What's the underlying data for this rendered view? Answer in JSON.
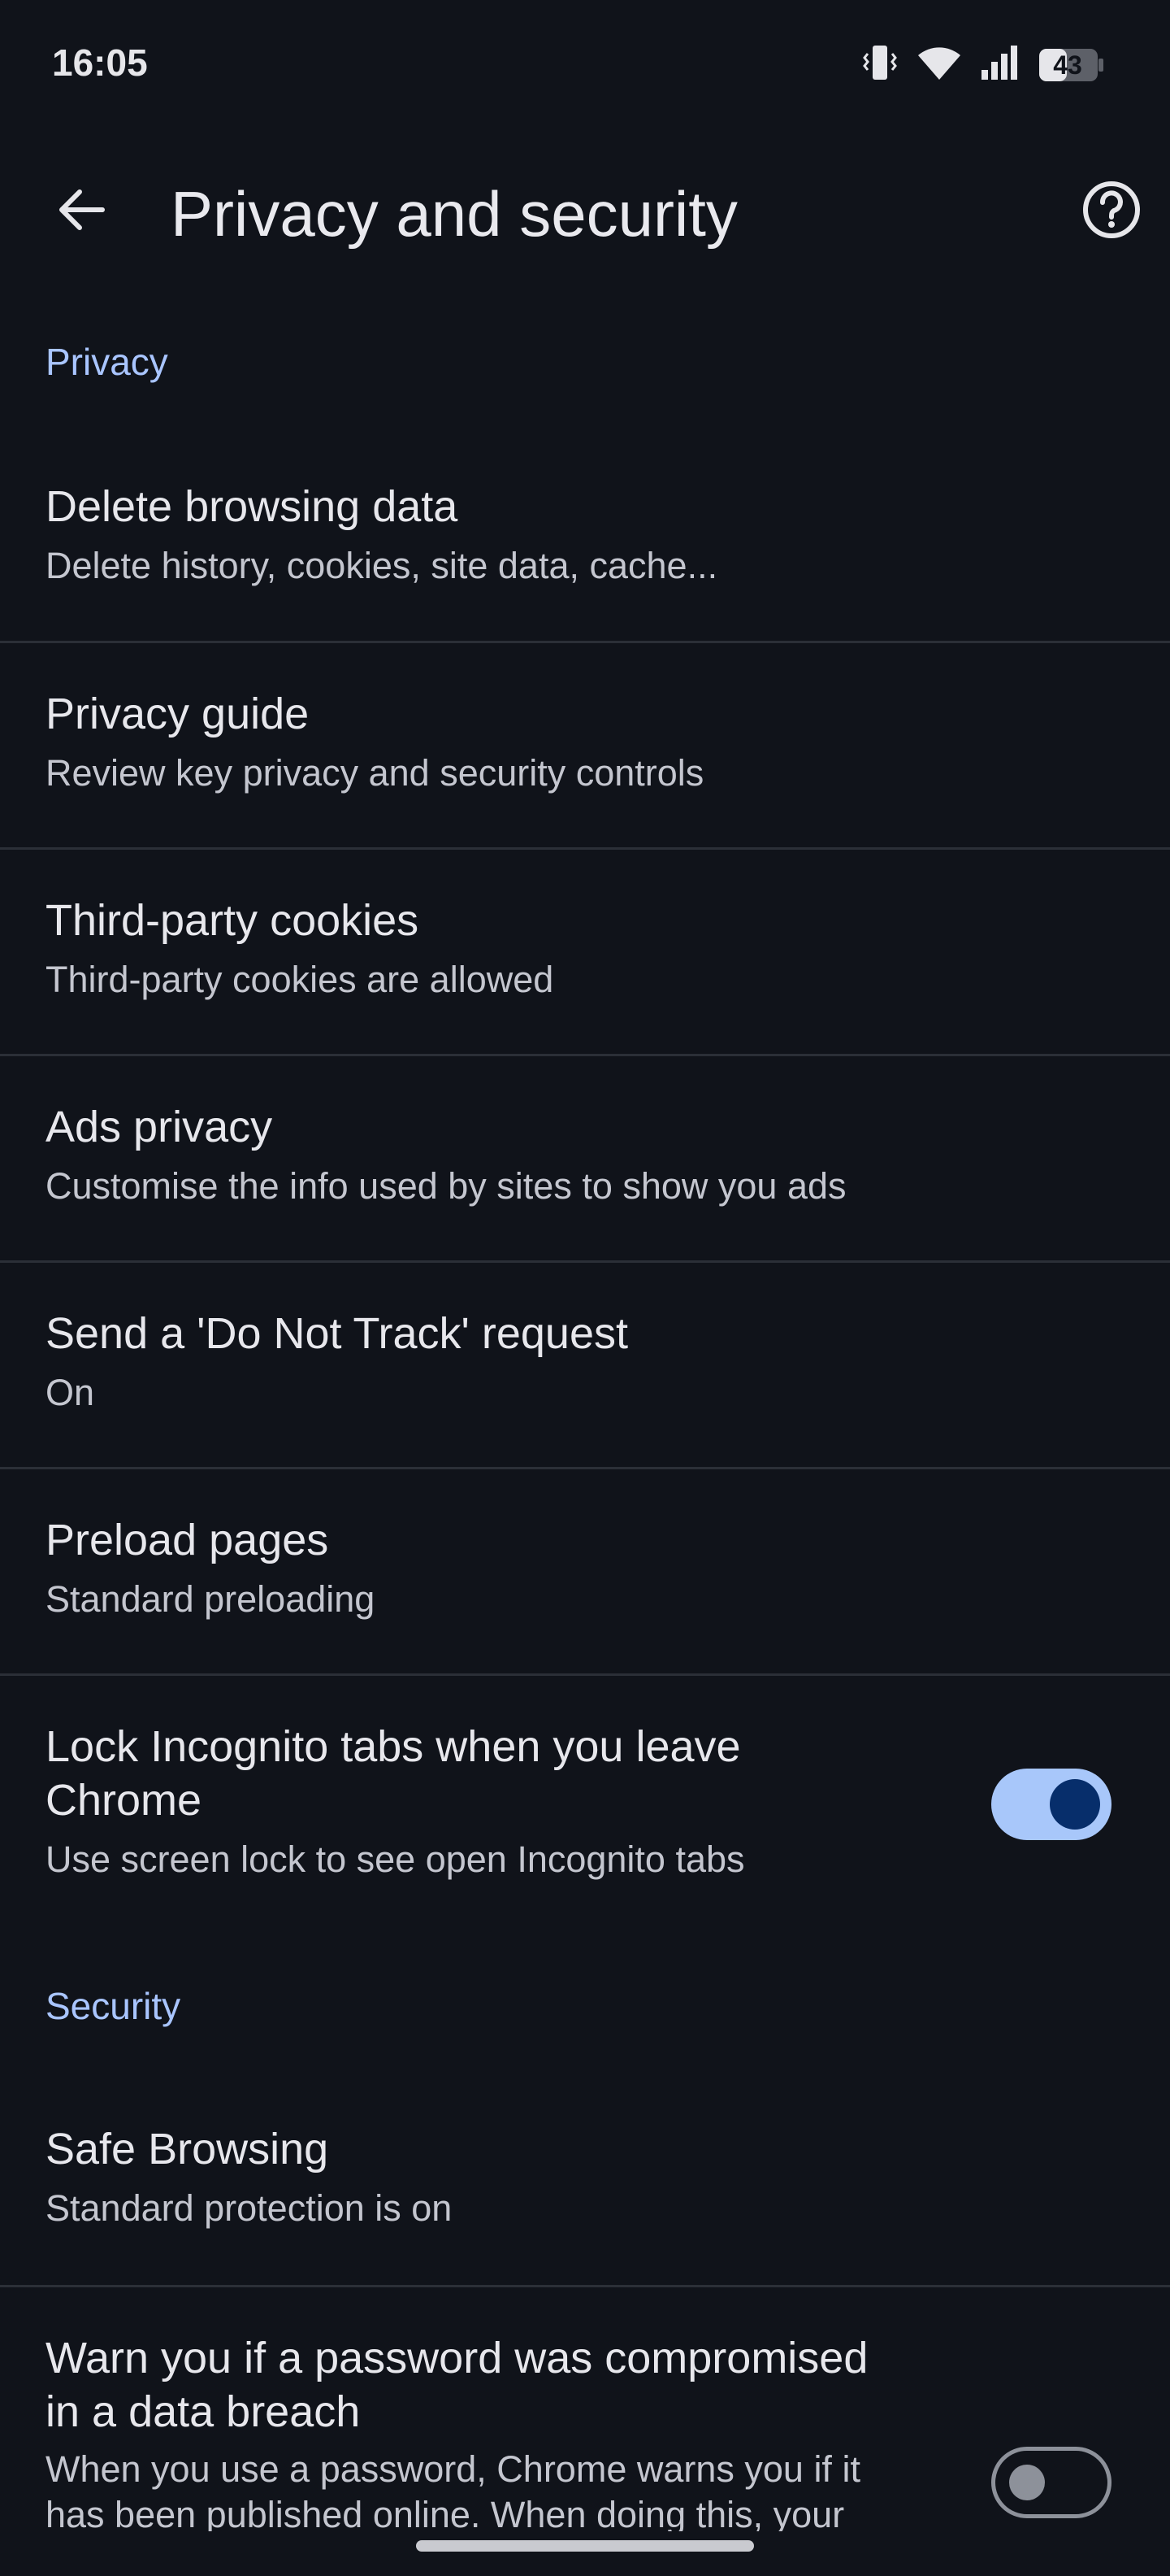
{
  "status_bar": {
    "time": "16:05",
    "battery": "43",
    "icons": [
      "vibrate-icon",
      "wifi-icon",
      "signal-icon",
      "battery-icon"
    ]
  },
  "app_bar": {
    "title": "Privacy and security",
    "back_icon": "arrow-left-icon",
    "help_icon": "help-circle-icon"
  },
  "sections": {
    "privacy_header": "Privacy",
    "security_header": "Security"
  },
  "items": {
    "delete_browsing_data": {
      "title": "Delete browsing data",
      "subtitle": "Delete history, cookies, site data, cache..."
    },
    "privacy_guide": {
      "title": "Privacy guide",
      "subtitle": "Review key privacy and security controls"
    },
    "third_party_cookies": {
      "title": "Third-party cookies",
      "subtitle": "Third-party cookies are allowed"
    },
    "ads_privacy": {
      "title": "Ads privacy",
      "subtitle": "Customise the info used by sites to show you ads"
    },
    "do_not_track": {
      "title": "Send a 'Do Not Track' request",
      "subtitle": "On"
    },
    "preload_pages": {
      "title": "Preload pages",
      "subtitle": "Standard preloading"
    },
    "lock_incognito": {
      "title_line1": "Lock Incognito tabs when you leave",
      "title_line2": "Chrome",
      "subtitle": "Use screen lock to see open Incognito tabs",
      "enabled": true
    },
    "safe_browsing": {
      "title": "Safe Browsing",
      "subtitle": "Standard protection is on"
    },
    "password_breach": {
      "title_line1": "Warn you if a password was compromised",
      "title_line2": "in a data breach",
      "subtitle_line1": "When you use a password, Chrome warns you if it",
      "subtitle_line2": "has been published online. When doing this, your",
      "enabled": false
    }
  },
  "colors": {
    "background": "#10131a",
    "accent": "#a9c5ff",
    "toggle_on_track": "#a8c7fa",
    "toggle_on_knob": "#072e6b"
  }
}
